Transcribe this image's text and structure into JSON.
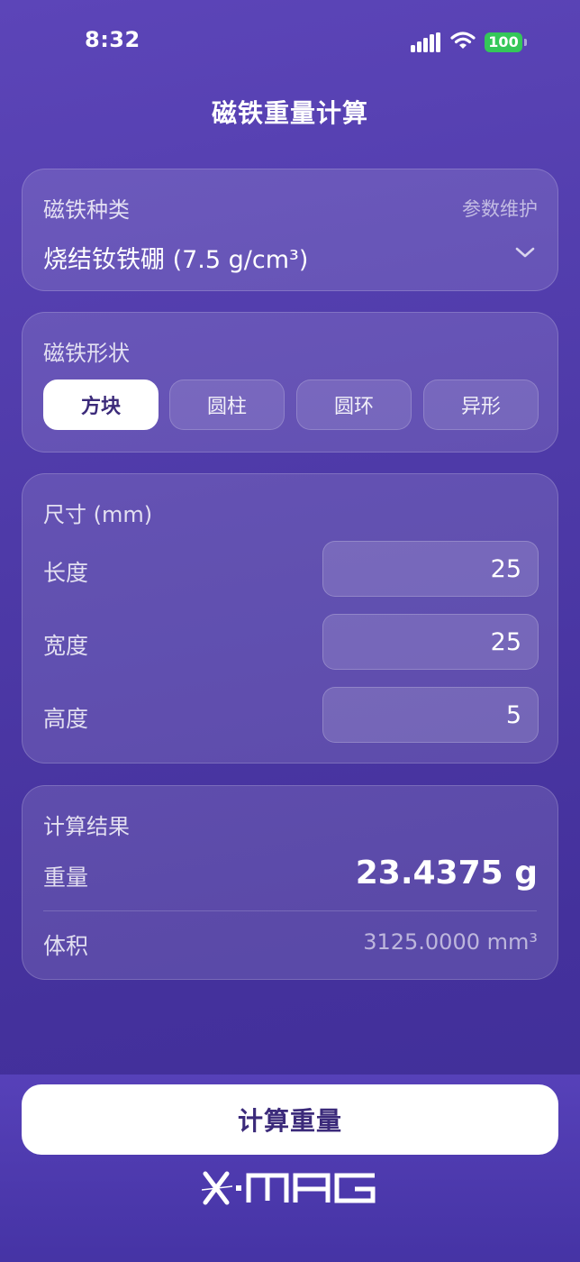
{
  "status": {
    "time": "8:32",
    "battery": "100"
  },
  "title": "磁铁重量计算",
  "magnet_type": {
    "label": "磁铁种类",
    "maintain": "参数维护",
    "selected": "烧结钕铁硼 (7.5 g/cm³)"
  },
  "shape": {
    "label": "磁铁形状",
    "options": [
      "方块",
      "圆柱",
      "圆环",
      "异形"
    ],
    "selected": "方块"
  },
  "size": {
    "label": "尺寸 (mm)",
    "length_label": "长度",
    "length": "25",
    "width_label": "宽度",
    "width": "25",
    "height_label": "高度",
    "height": "5"
  },
  "result": {
    "label": "计算结果",
    "weight_label": "重量",
    "weight": "23.4375 g",
    "volume_label": "体积",
    "volume": "3125.0000 mm³"
  },
  "action": {
    "calculate": "计算重量"
  },
  "logo_text": "X·MAG",
  "icons": [
    "signal-icon",
    "wifi-icon",
    "battery-icon",
    "chevron-down-icon",
    "xmag-logo"
  ]
}
